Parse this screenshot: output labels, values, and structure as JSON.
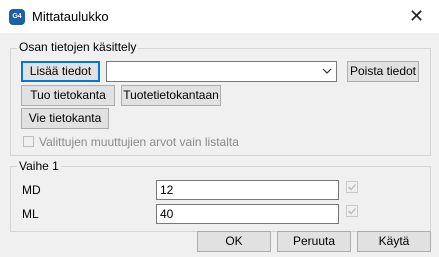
{
  "window": {
    "icon_text": "G4",
    "title": "Mittataulukko"
  },
  "data_group": {
    "label": "Osan tietojen käsittely",
    "add_button": "Lisää tiedot",
    "combo_value": "",
    "remove_button": "Poista tiedot",
    "import_button": "Tuo tietokanta",
    "product_db_button": "Tuotetietokantaan",
    "export_button": "Vie tietokanta",
    "only_selected_checkbox_label": "Valittujen muuttujien arvot vain listalta"
  },
  "phase_group": {
    "label": "Vaihe  1",
    "rows": [
      {
        "name": "MD",
        "value": "12"
      },
      {
        "name": "ML",
        "value": "40"
      }
    ]
  },
  "footer": {
    "ok": "OK",
    "cancel": "Peruuta",
    "apply": "Käytä"
  }
}
